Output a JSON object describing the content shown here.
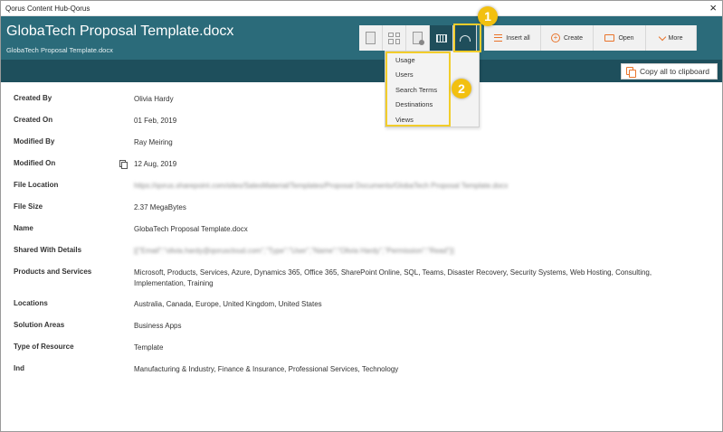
{
  "window": {
    "title": "Qorus Content Hub-Qorus",
    "close_glyph": "×"
  },
  "header": {
    "title": "GlobaTech Proposal Template.docx",
    "subtitle": "GlobaTech Proposal Template.docx"
  },
  "toolbar": {
    "insert_all": "Insert all",
    "create": "Create",
    "open": "Open",
    "more": "More"
  },
  "copy_all": "Copy all to clipboard",
  "dropdown": {
    "items": [
      "Usage",
      "Users",
      "Search Terms",
      "Destinations",
      "Views"
    ]
  },
  "callouts": {
    "one": "1",
    "two": "2"
  },
  "properties": [
    {
      "label": "Created By",
      "value": "Olivia Hardy"
    },
    {
      "label": "Created On",
      "value": "01 Feb, 2019"
    },
    {
      "label": "Modified By",
      "value": "Ray Meiring"
    },
    {
      "label": "Modified On",
      "value": "12 Aug, 2019"
    },
    {
      "label": "File Location",
      "value": "https://qorus.sharepoint.com/sites/SalesMaterial/Templates/Proposal Documents/GlobaTech Proposal Template.docx"
    },
    {
      "label": "File Size",
      "value": "2.37 MegaBytes"
    },
    {
      "label": "Name",
      "value": "GlobaTech Proposal Template.docx"
    },
    {
      "label": "Shared With Details",
      "value": "[{\"Email\":\"olivia.hardy@qoruscloud.com\",\"Type\":\"User\",\"Name\":\"Olivia Hardy\",\"Permission\":\"Read\"}]"
    },
    {
      "label": "Products and Services",
      "value": "Microsoft, Products, Services, Azure, Dynamics 365, Office 365, SharePoint Online, SQL, Teams, Disaster Recovery, Security Systems, Web Hosting, Consulting, Implementation, Training"
    },
    {
      "label": "Locations",
      "value": "Australia, Canada, Europe, United Kingdom, United States"
    },
    {
      "label": "Solution Areas",
      "value": "Business Apps"
    },
    {
      "label": "Type of Resource",
      "value": "Template"
    },
    {
      "label": "Ind",
      "value": "Manufacturing & Industry, Finance & Insurance, Professional Services, Technology"
    }
  ]
}
